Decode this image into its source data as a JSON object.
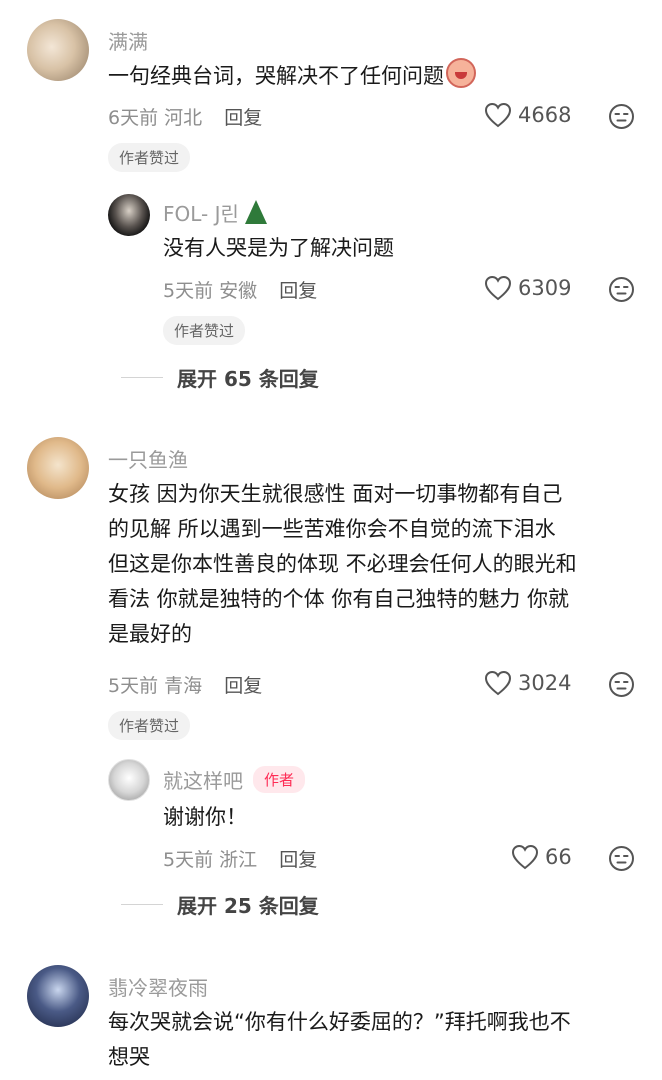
{
  "comments": [
    {
      "username": "满满",
      "text": "一句经典台词，哭解决不了任何问题",
      "time": "6天前",
      "location": "河北",
      "reply_label": "回复",
      "likes": "4668",
      "badge": "作者赞过",
      "replies": [
        {
          "username": "FOL- J린",
          "text": "没有人哭是为了解决问题",
          "time": "5天前",
          "location": "安徽",
          "reply_label": "回复",
          "likes": "6309",
          "badge": "作者赞过"
        }
      ],
      "expand_label": "展开 65 条回复"
    },
    {
      "username": "一只鱼渔",
      "text_lines": [
        "女孩 因为你天生就很感性 面对一切事物都有自己",
        "的见解 所以遇到一些苦难你会不自觉的流下泪水",
        "但这是你本性善良的体现 不必理会任何人的眼光和",
        "看法 你就是独特的个体 你有自己独特的魅力 你就",
        "是最好的"
      ],
      "time": "5天前",
      "location": "青海",
      "reply_label": "回复",
      "likes": "3024",
      "badge": "作者赞过",
      "replies": [
        {
          "username": "就这样吧",
          "author_tag": "作者",
          "text": "谢谢你！",
          "time": "5天前",
          "location": "浙江",
          "reply_label": "回复",
          "likes": "66"
        }
      ],
      "expand_label": "展开 25 条回复"
    },
    {
      "username": "翡冷翠夜雨",
      "text_lines": [
        "每次哭就会说“你有什么好委屈的？”拜托啊我也不",
        "想哭"
      ]
    }
  ],
  "icons": {
    "like": "heart-outline-icon",
    "dislike": "neutral-face-icon",
    "emoji": "crying-face-emoji",
    "tree": "evergreen-tree-emoji"
  }
}
